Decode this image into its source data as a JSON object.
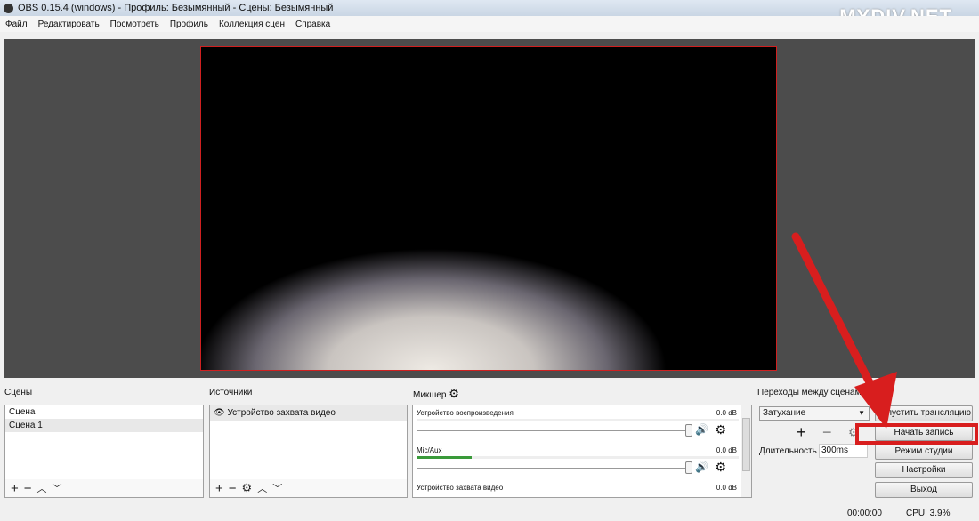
{
  "window": {
    "title": "OBS 0.15.4 (windows) - Профиль: Безымянный - Сцены: Безымянный"
  },
  "watermark": "MYDIV.NET",
  "menu": [
    "Файл",
    "Редактировать",
    "Посмотреть",
    "Профиль",
    "Коллекция сцен",
    "Справка"
  ],
  "scenes": {
    "label": "Сцены",
    "items": [
      "Сцена",
      "Сцена 1"
    ],
    "selected": 1
  },
  "sources": {
    "label": "Источники",
    "items": [
      "Устройство захвата видео"
    ]
  },
  "mixer": {
    "label": "Микшер",
    "channels": [
      {
        "name": "Устройство воспроизведения",
        "level": "0.0 dB",
        "meter": 0
      },
      {
        "name": "Mic/Aux",
        "level": "0.0 dB",
        "meter": 0.17
      },
      {
        "name": "Устройство захвата видео",
        "level": "0.0 dB",
        "meter": 0
      }
    ]
  },
  "transitions": {
    "label": "Переходы между сценами",
    "selected": "Затухание",
    "duration_label": "Длительность",
    "duration": "300ms"
  },
  "controls": [
    "Запустить трансляцию",
    "Начать запись",
    "Режим студии",
    "Настройки",
    "Выход"
  ],
  "highlight_color": "#d81e1e",
  "status": {
    "time": "00:00:00",
    "cpu": "CPU: 3.9%"
  }
}
